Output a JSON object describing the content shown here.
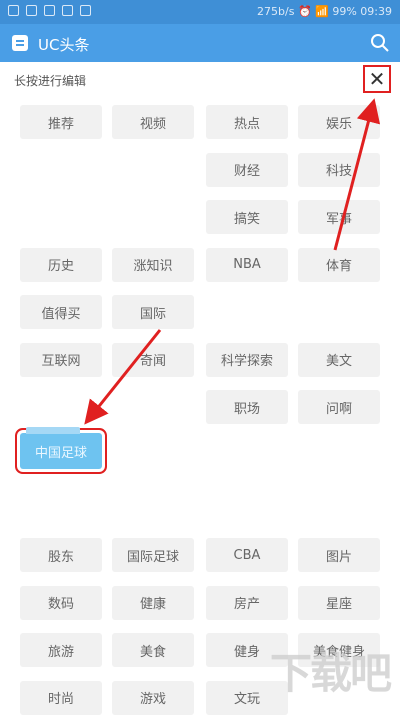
{
  "statusbar": {
    "right_text": "275b/s  ⏰  📶  99%  09:39"
  },
  "app": {
    "title": "UC头条"
  },
  "editor": {
    "hint": "长按进行编辑",
    "close_label": "✕",
    "dragging_label": "中国足球"
  },
  "channels_top": [
    "推荐",
    "视频",
    "热点",
    "娱乐",
    "",
    "",
    "财经",
    "科技",
    "",
    "",
    "搞笑",
    "军事",
    "历史",
    "涨知识",
    "NBA",
    "体育",
    "值得买",
    "国际",
    "",
    "",
    "互联网",
    "奇闻",
    "科学探索",
    "美文",
    "",
    "",
    "职场",
    "问啊"
  ],
  "channels_bottom": [
    "股东",
    "国际足球",
    "CBA",
    "图片",
    "数码",
    "健康",
    "房产",
    "星座",
    "旅游",
    "美食",
    "健身",
    "美食健身",
    "时尚",
    "游戏",
    "文玩",
    ""
  ],
  "watermark": "下载吧"
}
